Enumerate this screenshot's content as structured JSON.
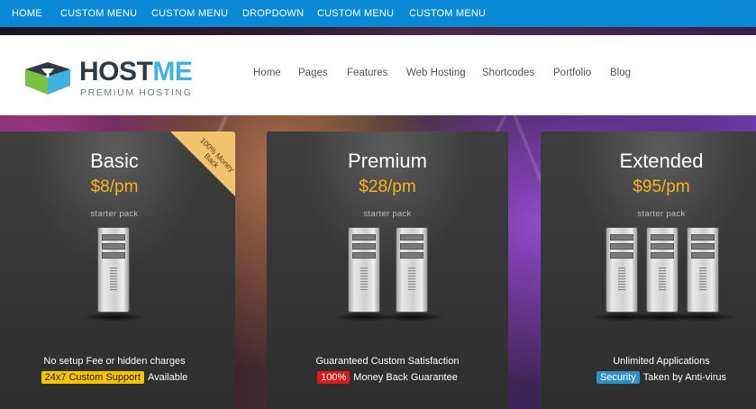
{
  "topbar": {
    "items": [
      "HOME",
      "CUSTOM MENU",
      "CUSTOM MENU",
      "DROPDOWN",
      "CUSTOM MENU",
      "CUSTOM MENU"
    ]
  },
  "logo": {
    "part1": "HOST",
    "part2": "ME",
    "tagline": "PREMIUM HOSTING"
  },
  "nav": {
    "items": [
      "Home",
      "Pages",
      "Features",
      "Web Hosting",
      "Shortcodes",
      "Portfolio",
      "Blog"
    ]
  },
  "plans": [
    {
      "title": "Basic",
      "price": "$8/pm",
      "subtitle": "starter pack",
      "servers": 1,
      "feature1": "No setup Fee or hidden charges",
      "badge": "24x7 Custom Support",
      "badge_color": "#f5c400",
      "feature2_rest": "Available",
      "ribbon": "100% Money Back"
    },
    {
      "title": "Premium",
      "price": "$28/pm",
      "subtitle": "starter pack",
      "servers": 2,
      "feature1": "Guaranteed Custom Satisfaction",
      "badge": "100%",
      "badge_color": "#d81a1a",
      "feature2_rest": "Money Back Guarantee"
    },
    {
      "title": "Extended",
      "price": "$95/pm",
      "subtitle": "starter pack",
      "servers": 3,
      "feature1": "Unlimited Applications",
      "badge": "Security",
      "badge_color": "#2e8fc9",
      "feature2_rest": "Taken by Anti-virus"
    }
  ],
  "colors": {
    "topbar": "#0a8ad6",
    "price": "#f5b51b",
    "logo_accent": "#3fb2e0"
  }
}
